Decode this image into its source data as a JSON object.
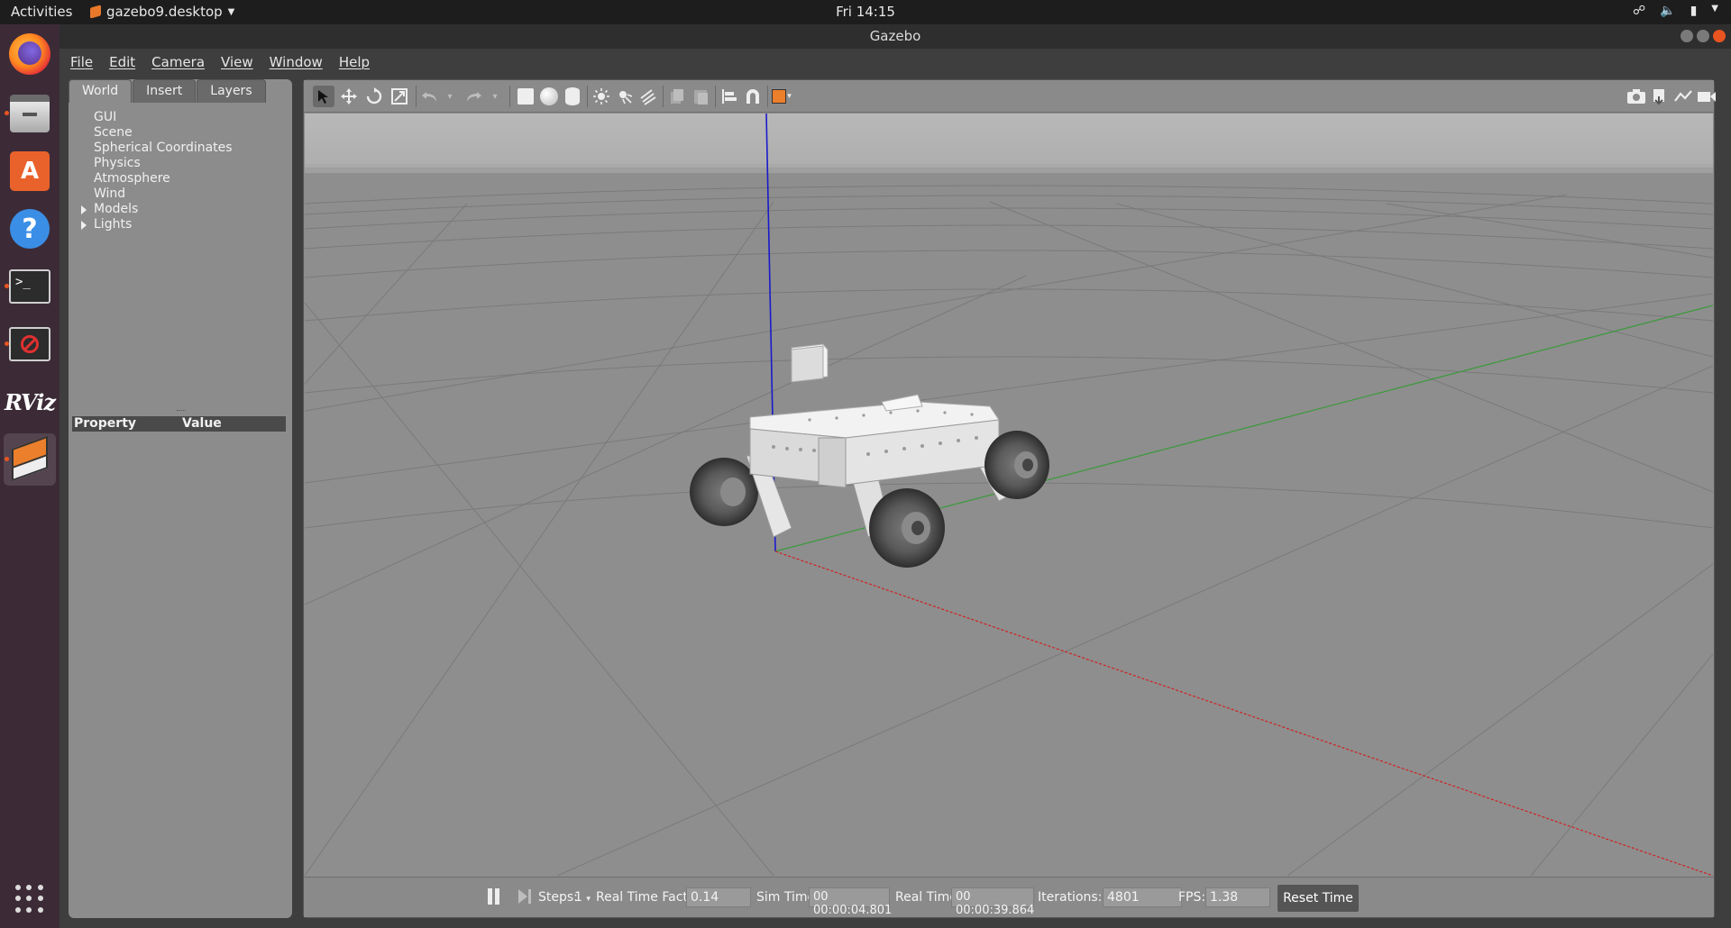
{
  "topbar": {
    "activities": "Activities",
    "app_menu": "gazebo9.desktop",
    "clock": "Fri 14:15"
  },
  "dock": {
    "items": [
      {
        "name": "firefox-icon"
      },
      {
        "name": "files-icon"
      },
      {
        "name": "software-center-icon"
      },
      {
        "name": "help-icon"
      },
      {
        "name": "terminal-icon"
      },
      {
        "name": "blocked-app-icon"
      },
      {
        "name": "rviz-icon",
        "label": "RViz"
      },
      {
        "name": "gazebo-icon"
      },
      {
        "name": "show-applications-icon"
      }
    ]
  },
  "window": {
    "title": "Gazebo",
    "menu": [
      "File",
      "Edit",
      "Camera",
      "View",
      "Window",
      "Help"
    ]
  },
  "left_panel": {
    "tabs": [
      "World",
      "Insert",
      "Layers"
    ],
    "selected_tab": "World",
    "tree": [
      "GUI",
      "Scene",
      "Spherical Coordinates",
      "Physics",
      "Atmosphere",
      "Wind",
      "Models",
      "Lights"
    ],
    "property_header": {
      "property": "Property",
      "value": "Value"
    }
  },
  "toolbar": {
    "tools": [
      "select-mode-icon",
      "translate-mode-icon",
      "rotate-mode-icon",
      "scale-mode-icon",
      "undo-icon",
      "redo-icon",
      "box-shape-icon",
      "sphere-shape-icon",
      "cylinder-shape-icon",
      "point-light-icon",
      "spot-light-icon",
      "directional-light-icon",
      "copy-icon",
      "paste-icon",
      "align-icon",
      "snap-icon",
      "view-angle-icon",
      "screenshot-icon",
      "log-icon",
      "plot-icon",
      "record-video-icon"
    ]
  },
  "bottom_bar": {
    "steps_label": "Steps:",
    "steps_value": "1",
    "rtf_label": "Real Time Factor:",
    "rtf_value": "0.14",
    "sim_time_label": "Sim Time:",
    "sim_time_value": "00 00:00:04.801",
    "real_time_label": "Real Time:",
    "real_time_value": "00 00:00:39.864",
    "iterations_label": "Iterations:",
    "iterations_value": "4801",
    "fps_label": "FPS:",
    "fps_value": "1.38",
    "reset_label": "Reset Time"
  },
  "colors": {
    "dock_bg": "#3c2b37",
    "viewport_sky": "#b4b4b4",
    "viewport_ground": "#8e8e8e",
    "axis_x": "#d22020",
    "axis_y": "#3a9a3a",
    "axis_z": "#1a1acc",
    "accent_orange": "#e95420"
  }
}
